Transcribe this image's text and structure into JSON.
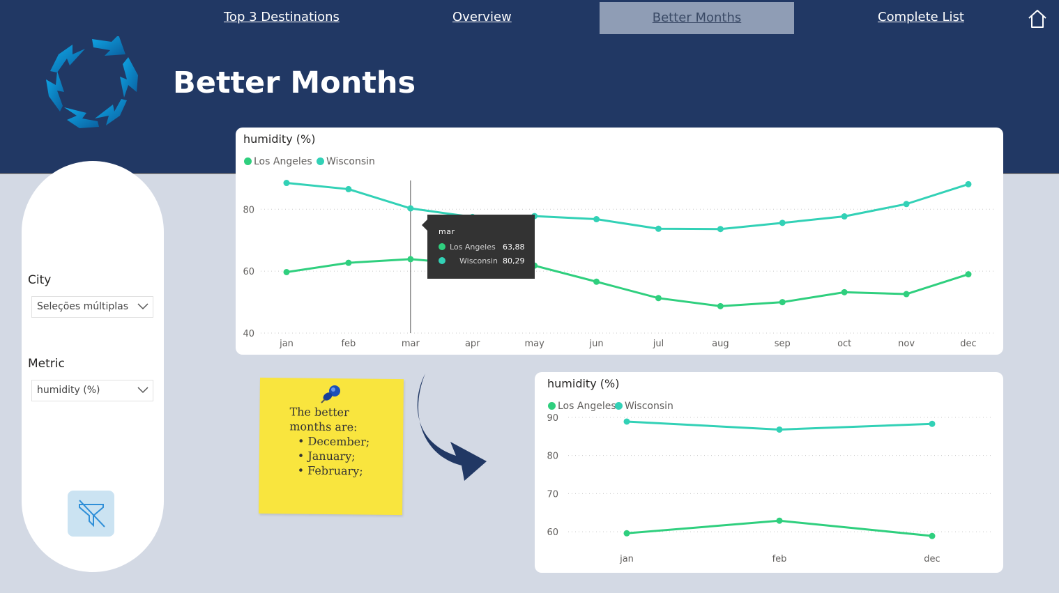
{
  "nav": {
    "links": [
      "Top 3 Destinations",
      "Overview",
      "Better Months",
      "Complete List"
    ],
    "active": "Better Months",
    "home_icon": "home-icon"
  },
  "logo_icon": "circular-arrows-logo-icon",
  "page_title": "Better Months",
  "filters": {
    "city": {
      "label": "City",
      "value": "Seleções múltiplas"
    },
    "metric": {
      "label": "Metric",
      "value": "humidity (%)"
    },
    "clear_icon": "clear-filter-icon"
  },
  "colors": {
    "header": "#213864",
    "los_angeles": "#2fcf7e",
    "wisconsin": "#32d1b6",
    "note": "#f9e53e"
  },
  "chart_data": [
    {
      "type": "line",
      "title": "humidity (%)",
      "categories": [
        "jan",
        "feb",
        "mar",
        "apr",
        "may",
        "jun",
        "jul",
        "aug",
        "sep",
        "oct",
        "nov",
        "dec"
      ],
      "series": [
        {
          "name": "Los Angeles",
          "color": "#2fcf7e",
          "values": [
            59.7,
            62.7,
            63.88,
            62.2,
            61.8,
            56.6,
            51.3,
            48.7,
            50.0,
            53.2,
            52.6,
            59.0
          ]
        },
        {
          "name": "Wisconsin",
          "color": "#32d1b6",
          "values": [
            88.5,
            86.5,
            80.29,
            77.5,
            77.8,
            76.8,
            73.7,
            73.6,
            75.6,
            77.7,
            81.7,
            88.1
          ]
        }
      ],
      "yticks": [
        40,
        60,
        80
      ],
      "ylim": [
        40,
        92
      ],
      "legend_position": "top-left",
      "grid": true,
      "tooltip": {
        "category": "mar",
        "rows": [
          {
            "name": "Los Angeles",
            "value": "63,88"
          },
          {
            "name": "Wisconsin",
            "value": "80,29"
          }
        ]
      }
    },
    {
      "type": "line",
      "title": "humidity (%)",
      "categories": [
        "jan",
        "feb",
        "dec"
      ],
      "series": [
        {
          "name": "Los Angeles",
          "color": "#2fcf7e",
          "values": [
            59.6,
            62.9,
            58.9
          ]
        },
        {
          "name": "Wisconsin",
          "color": "#32d1b6",
          "values": [
            88.9,
            86.8,
            88.3
          ]
        }
      ],
      "yticks": [
        60,
        70,
        80,
        90
      ],
      "ylim": [
        56,
        92
      ],
      "legend_position": "top-left",
      "grid": true
    }
  ],
  "note": {
    "heading_lines": [
      "The better",
      "months are:"
    ],
    "items": [
      "December;",
      "January;",
      "February;"
    ],
    "pin_icon": "pushpin-icon",
    "arrow_icon": "curved-arrow-icon"
  }
}
